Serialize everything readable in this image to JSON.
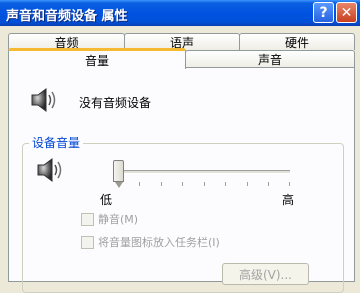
{
  "window": {
    "title": "声音和音频设备 属性"
  },
  "titlebar_buttons": {
    "help": "?",
    "close": "✕"
  },
  "tabs": {
    "row1": [
      "音频",
      "语声",
      "硬件"
    ],
    "row2": [
      "音量",
      "声音"
    ],
    "selected": "音量"
  },
  "volume_tab": {
    "device_message": "没有音频设备",
    "group_title": "设备音量",
    "slider": {
      "low_label": "低",
      "high_label": "高",
      "value": 0
    },
    "mute_label": "静音(M)",
    "tray_label": "将音量图标放入任务栏(I)",
    "advanced_label": "高级(V)..."
  },
  "colors": {
    "titlebar": "#0053e1",
    "accent_tab": "#f5b932",
    "group_title": "#0046d5",
    "disabled_text": "#a0a0a0"
  },
  "icons": [
    "speaker-icon",
    "help-icon",
    "close-icon"
  ]
}
